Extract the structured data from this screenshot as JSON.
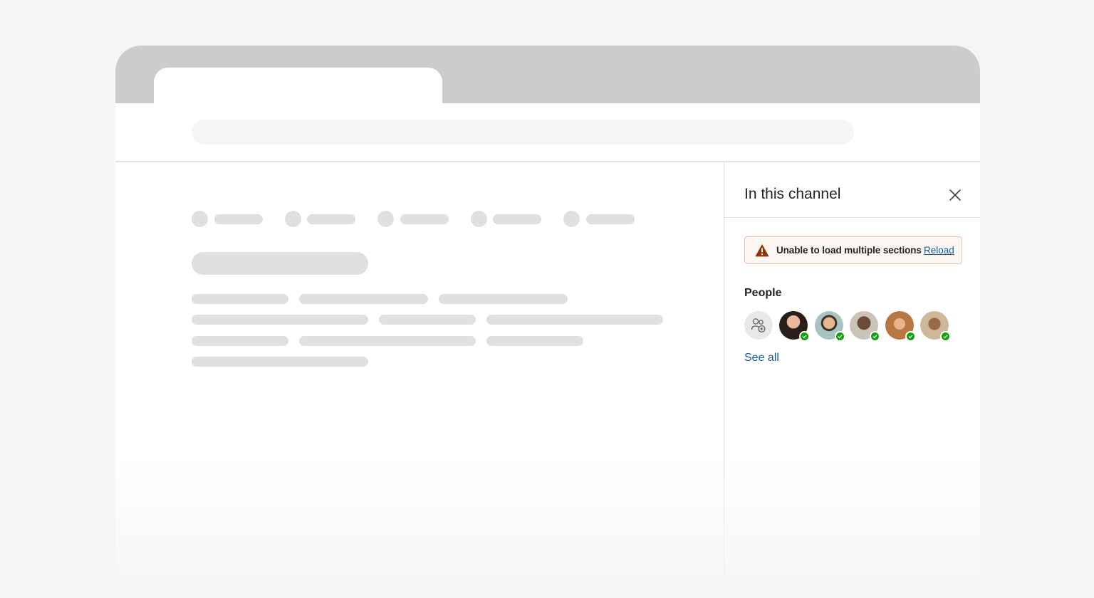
{
  "panel": {
    "title": "In this channel",
    "banner": {
      "message": "Unable to load multiple sections",
      "action_label": "Reload",
      "warning_color": "#8a3707"
    },
    "people": {
      "label": "People",
      "see_all_label": "See all",
      "presence_color": "#13a10e",
      "avatars": [
        {
          "name": "avatar-1",
          "presence": "available",
          "color": "#3a2a26"
        },
        {
          "name": "avatar-2",
          "presence": "available",
          "color": "#a7c4c2"
        },
        {
          "name": "avatar-3",
          "presence": "available",
          "color": "#6b5242"
        },
        {
          "name": "avatar-4",
          "presence": "available",
          "color": "#b8773e"
        },
        {
          "name": "avatar-5",
          "presence": "available",
          "color": "#7a5235"
        }
      ]
    }
  },
  "icons": {
    "close": "close-icon",
    "warning": "warning-icon",
    "add_person": "add-person-icon",
    "presence": "checkmark-icon"
  }
}
